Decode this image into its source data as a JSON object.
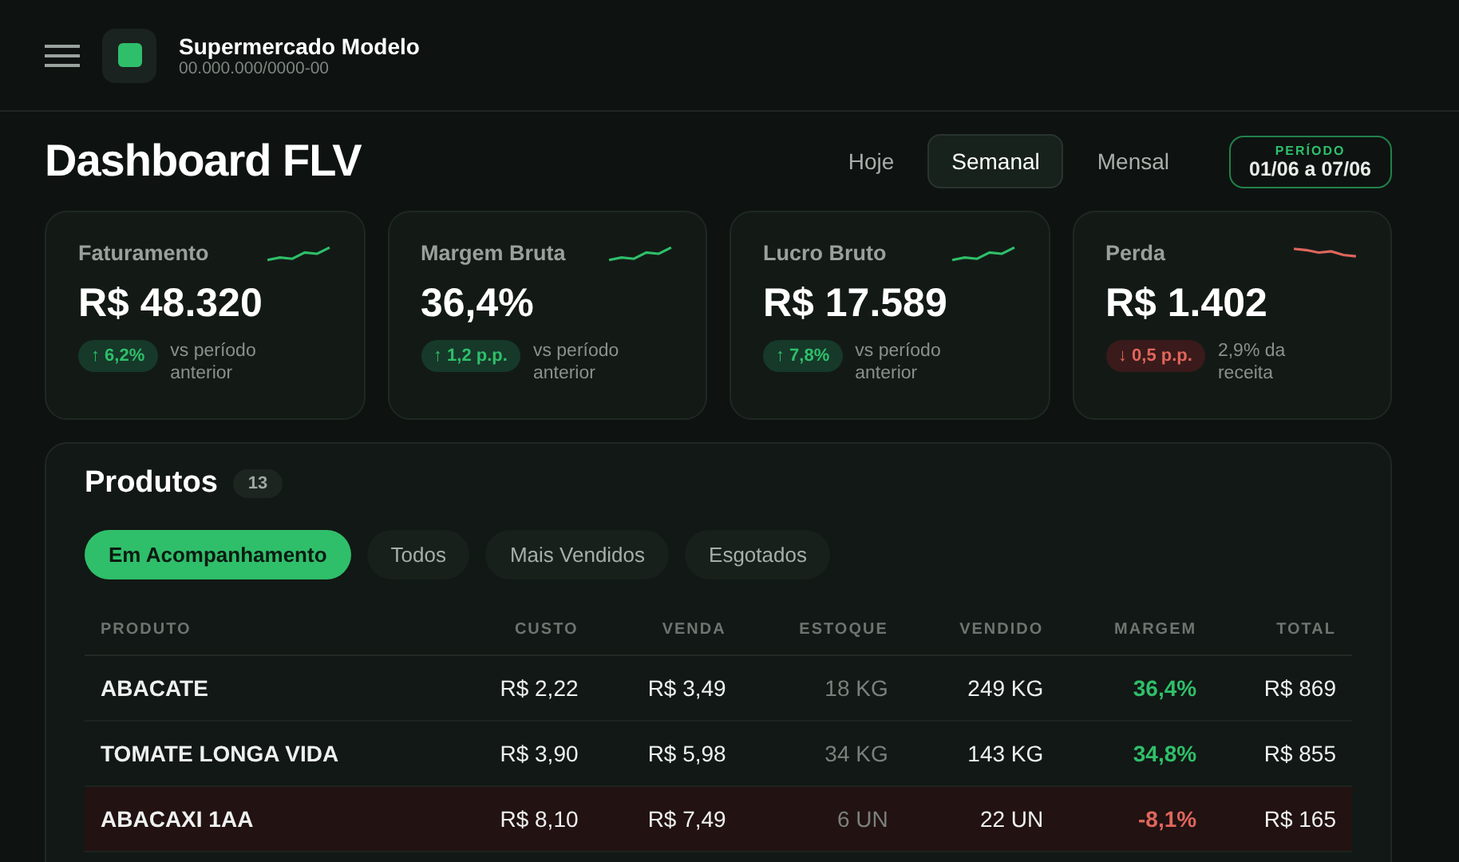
{
  "header": {
    "store_name": "Supermercado Modelo",
    "store_id": "00.000.000/0000-00"
  },
  "page_title": "Dashboard FLV",
  "period_tabs": [
    {
      "label": "Hoje",
      "selected": false
    },
    {
      "label": "Semanal",
      "selected": true
    },
    {
      "label": "Mensal",
      "selected": false
    }
  ],
  "period": {
    "label": "PERÍODO",
    "range": "01/06 a 07/06"
  },
  "kpis": [
    {
      "title": "Faturamento",
      "value": "R$ 48.320",
      "rising": true,
      "change": "↑ 6,2%",
      "note": "vs período anterior"
    },
    {
      "title": "Margem Bruta",
      "value": "36,4%",
      "rising": true,
      "change": "↑ 1,2 p.p.",
      "note": "vs período anterior"
    },
    {
      "title": "Lucro Bruto",
      "value": "R$ 17.589",
      "rising": true,
      "change": "↑ 7,8%",
      "note": "vs período anterior"
    },
    {
      "title": "Perda",
      "value": "R$ 1.402",
      "rising": false,
      "change": "↓ 0,5 p.p.",
      "note": "2,9% da receita"
    }
  ],
  "products": {
    "title": "Produtos",
    "count": "13",
    "filters": [
      {
        "label": "Em Acompanhamento",
        "selected": true
      },
      {
        "label": "Todos",
        "selected": false
      },
      {
        "label": "Mais Vendidos",
        "selected": false
      },
      {
        "label": "Esgotados",
        "selected": false
      }
    ],
    "columns": [
      "PRODUTO",
      "CUSTO",
      "VENDA",
      "ESTOQUE",
      "VENDIDO",
      "MARGEM",
      "TOTAL"
    ],
    "rows": [
      {
        "alert": false,
        "margin_positive": true,
        "cells": [
          "ABACATE",
          "R$ 2,22",
          "R$ 3,49",
          "18 KG",
          "249 KG",
          "36,4%",
          "R$ 869"
        ]
      },
      {
        "alert": false,
        "margin_positive": true,
        "cells": [
          "TOMATE LONGA VIDA",
          "R$ 3,90",
          "R$ 5,98",
          "34 KG",
          "143 KG",
          "34,8%",
          "R$ 855"
        ]
      },
      {
        "alert": true,
        "margin_positive": false,
        "cells": [
          "ABACAXI 1AA",
          "R$ 8,10",
          "R$ 7,49",
          "6 UN",
          "22 UN",
          "-8,1%",
          "R$ 165"
        ]
      }
    ]
  }
}
